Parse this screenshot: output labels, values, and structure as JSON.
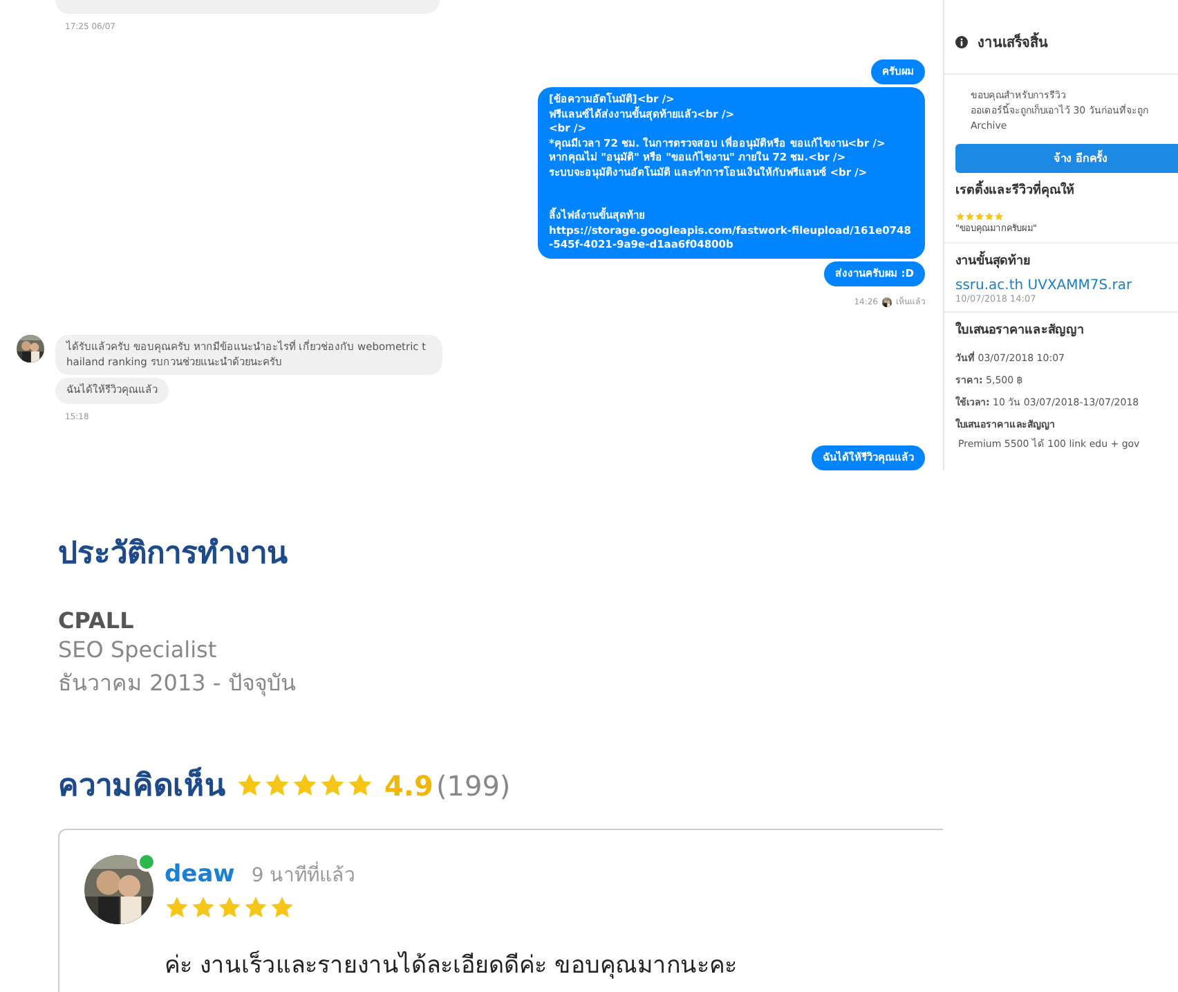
{
  "chat": {
    "messages": [
      {
        "kind": "cut",
        "time": "17:25 06/07"
      },
      {
        "kind": "outgoing",
        "paragraphs": [
          [
            "ครับผม"
          ]
        ]
      },
      {
        "kind": "outgoing",
        "paragraphs": [
          [
            "[ข้อความอัตโนมัติ]<br />",
            "ฟรีแลนซ์ได้ส่งงานขั้นสุดท้ายแล้ว<br />",
            "<br />",
            "*คุณมีเวลา 72 ชม. ในการตรวจสอบ เพื่ออนุมัติหรือ ขอแก้ไขงาน<br />",
            "หากคุณไม่ \"อนุมัติ\" หรือ \"ขอแก้ไขงาน\" ภายใน 72 ชม.<br />",
            "ระบบจะอนุมัติงานอัตโนมัติ และทำการโอนเงินให้กับฟรีแลนซ์ <br />"
          ],
          [
            "ลิ้งไฟล์งานขั้นสุดท้าย",
            "https://storage.googleapis.com/fastwork-fileupload/161e0748-545f-4021-9a9e-d1aa6f04800b"
          ]
        ]
      },
      {
        "kind": "outgoing",
        "paragraphs": [
          [
            "ส่งงานครับผม :D"
          ]
        ],
        "time": "14:26",
        "seen": "เห็นแล้ว"
      },
      {
        "kind": "incoming",
        "avatar": true,
        "paragraphs": [
          [
            "ได้รับแล้วครับ ขอบคุณครับ หากมีข้อแนะนำอะไรที่ เกี่ยวช่องกับ webometric thailand ranking รบกวนช่วยแนะนำด้วยนะครับ"
          ]
        ]
      },
      {
        "kind": "incoming",
        "avatar": false,
        "paragraphs": [
          [
            "ฉันได้ให้รีวิวคุณแล้ว"
          ]
        ],
        "time": "15:18"
      },
      {
        "kind": "outgoing",
        "paragraphs": [
          [
            "ฉันได้ให้รีวิวคุณแล้ว"
          ]
        ]
      }
    ]
  },
  "order_panel": {
    "title": "งานเสร็จสิ้น",
    "notice": [
      "ขอบคุณสำหรับการรีวิว",
      "ออเดอร์นี้จะถูกเก็บเอาไว้ 30 วันก่อนที่จะถูก Archive"
    ],
    "rehire_button": "จ้าง อีกครั้ง",
    "rating": {
      "title": "เรตติ้งและรีวิวที่คุณให้",
      "stars": 5,
      "comment": "\"ขอบคุณมากครับผม\""
    },
    "final_work": {
      "title": "งานขั้นสุดท้าย",
      "file": "ssru.ac.th UVXAMM7S.rar",
      "date": "10/07/2018 14:07"
    },
    "quote": {
      "title": "ใบเสนอราคาและสัญญา",
      "rows": [
        {
          "label": "วันที่",
          "value": "03/07/2018 10:07"
        },
        {
          "label": "ราคา:",
          "value": "5,500 ฿"
        },
        {
          "label": "ใช้เวลา:",
          "value": "10 วัน 03/07/2018-13/07/2018"
        }
      ],
      "subtitle": "ใบเสนอราคาและสัญญา",
      "description": "Premium 5500 ได้ 100 link edu + gov"
    }
  },
  "work_history": {
    "title": "ประวัติการทำงาน",
    "company": "CPALL",
    "position": "SEO Specialist",
    "period": "ธันวาคม 2013 - ปัจจุบัน"
  },
  "reviews": {
    "title": "ความคิดเห็น",
    "stars": 5,
    "score": "4.9",
    "count": "(199)",
    "items": [
      {
        "name": "deaw",
        "online": true,
        "time": "9 นาทีที่แล้ว",
        "stars": 5,
        "text": "ค่ะ งานเร็วและรายงานได้ละเอียดดีค่ะ ขอบคุณมากนะคะ"
      }
    ]
  }
}
